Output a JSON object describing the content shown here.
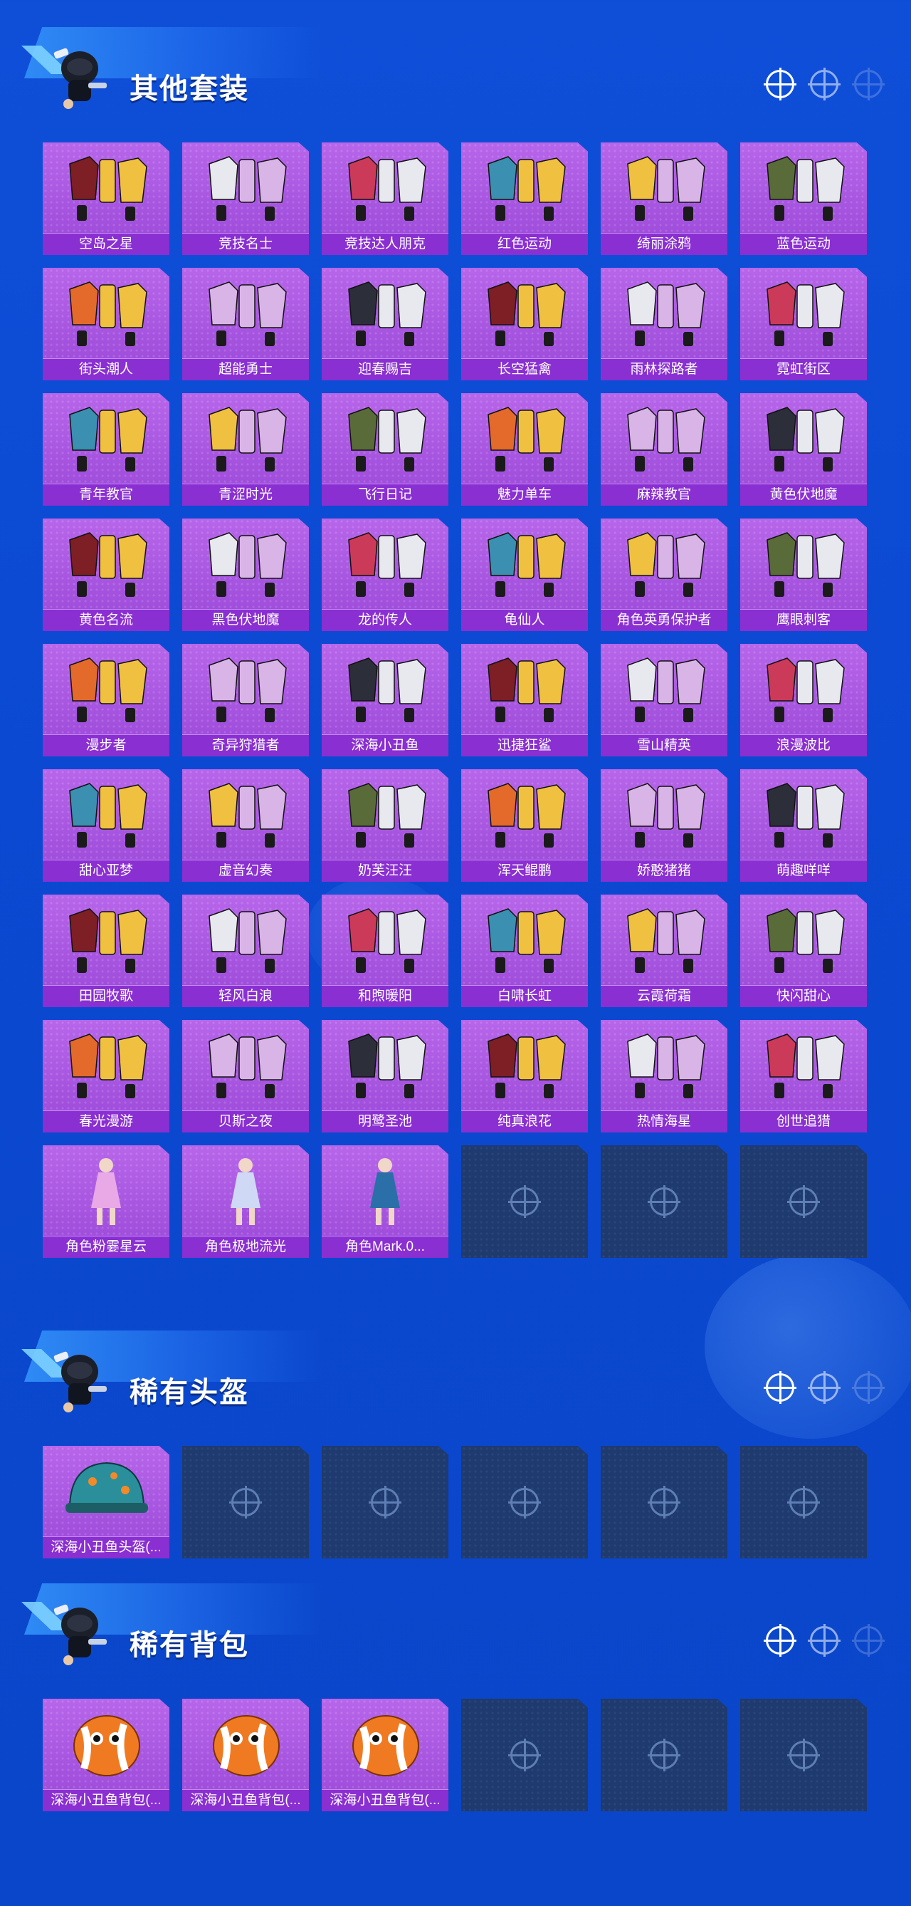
{
  "sections": [
    {
      "title": "其他套装",
      "items": [
        "空岛之星",
        "竞技名士",
        "竞技达人朋克",
        "红色运动",
        "绮丽涂鸦",
        "蓝色运动",
        "街头潮人",
        "超能勇士",
        "迎春赐吉",
        "长空猛禽",
        "雨林探路者",
        "霓虹街区",
        "青年教官",
        "青涩时光",
        "飞行日记",
        "魅力单车",
        "麻辣教官",
        "黄色伏地魔",
        "黄色名流",
        "黑色伏地魔",
        "龙的传人",
        "龟仙人",
        "角色英勇保护者",
        "鹰眼刺客",
        "漫步者",
        "奇异狩猎者",
        "深海小丑鱼",
        "迅捷狂鲨",
        "雪山精英",
        "浪漫波比",
        "甜心亚梦",
        "虚音幻奏",
        "奶芙汪汪",
        "浑天鲲鹏",
        "娇憨猪猪",
        "萌趣咩咩",
        "田园牧歌",
        "轻风白浪",
        "和煦暖阳",
        "白啸长虹",
        "云霞荷霜",
        "快闪甜心",
        "春光漫游",
        "贝斯之夜",
        "明鹭圣池",
        "纯真浪花",
        "热情海星",
        "创世追猎",
        "角色粉霎星云",
        "角色极地流光",
        "角色Mark.0..."
      ],
      "empty_slots": 3
    },
    {
      "title": "稀有头盔",
      "items": [
        "深海小丑鱼头盔(..."
      ],
      "empty_slots": 5
    },
    {
      "title": "稀有背包",
      "items": [
        "深海小丑鱼背包(...",
        "深海小丑鱼背包(...",
        "深海小丑鱼背包(..."
      ],
      "empty_slots": 3
    }
  ],
  "colors": {
    "background": "#0b49d2",
    "card": "#a556e0",
    "label_bar": "#8a2fd1",
    "empty_card": "#1f3a6e"
  },
  "icons": {
    "header_mascot": "skydiver-mascot-icon",
    "header_targets": "crosshair-target-icon",
    "empty_slot": "crosshair-target-icon"
  }
}
